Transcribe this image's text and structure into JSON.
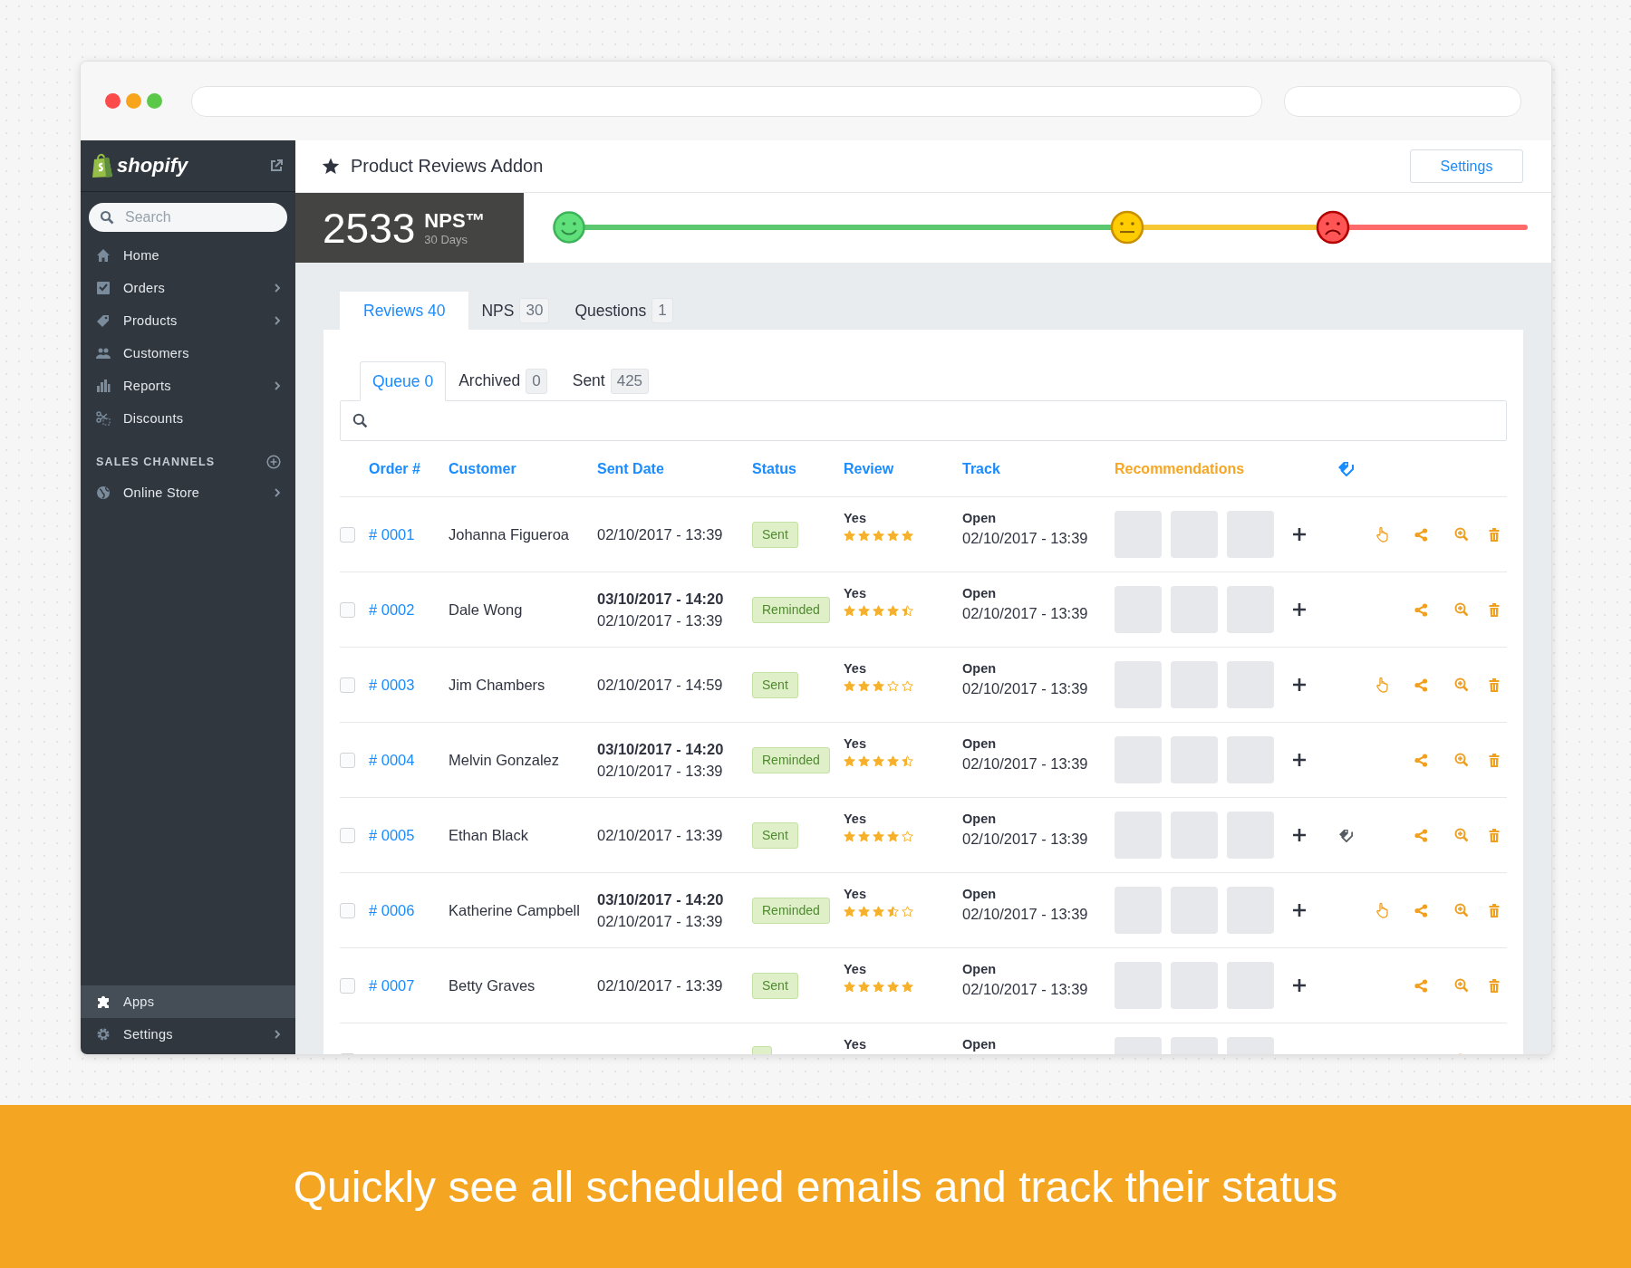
{
  "sidebar": {
    "logo": "shopify",
    "search": {
      "placeholder": "Search"
    },
    "items": [
      {
        "label": "Home",
        "has_children": false,
        "selected": false
      },
      {
        "label": "Orders",
        "has_children": true,
        "selected": false
      },
      {
        "label": "Products",
        "has_children": true,
        "selected": false
      },
      {
        "label": "Customers",
        "has_children": false,
        "selected": false
      },
      {
        "label": "Reports",
        "has_children": true,
        "selected": false
      },
      {
        "label": "Discounts",
        "has_children": false,
        "selected": false
      }
    ],
    "section_title": "SALES CHANNELS",
    "channels": [
      {
        "label": "Online Store",
        "has_children": true,
        "selected": false
      }
    ],
    "bottom_items": [
      {
        "label": "Apps",
        "has_children": false,
        "selected": true
      },
      {
        "label": "Settings",
        "has_children": true,
        "selected": false
      }
    ]
  },
  "header": {
    "title": "Product Reviews Addon",
    "settings_button": "Settings"
  },
  "nps": {
    "score": "2533",
    "label": "NPS™",
    "period": "30 Days"
  },
  "tabs": [
    {
      "label": "Reviews",
      "count": "40",
      "selected": true
    },
    {
      "label": "NPS",
      "count": "30",
      "selected": false
    },
    {
      "label": "Questions",
      "count": "1",
      "selected": false
    }
  ],
  "subtabs": [
    {
      "label": "Queue",
      "count": "0",
      "selected": true
    },
    {
      "label": "Archived",
      "count": "0",
      "selected": false
    },
    {
      "label": "Sent",
      "count": "425",
      "selected": false
    }
  ],
  "table": {
    "columns": [
      "Order #",
      "Customer",
      "Sent Date",
      "Status",
      "Review",
      "Track",
      "Recommendations"
    ],
    "rows": [
      {
        "checked": false,
        "order": "# 0001",
        "customer": "Johanna Figueroa",
        "sent_date": "02/10/2017 - 13:39",
        "status": "Sent",
        "review": "Yes",
        "stars": 5,
        "track": "Open",
        "track_date": "02/10/2017 - 13:39",
        "pointer": true,
        "tagged": false
      },
      {
        "checked": false,
        "order": "# 0002",
        "customer": "Dale Wong",
        "reminded_date": "03/10/2017 - 14:20",
        "sent_date": "02/10/2017 - 13:39",
        "status": "Reminded",
        "review": "Yes",
        "stars": 4.5,
        "track": "Open",
        "track_date": "02/10/2017 - 13:39",
        "pointer": false,
        "tagged": false
      },
      {
        "checked": false,
        "order": "# 0003",
        "customer": "Jim Chambers",
        "sent_date": "02/10/2017 - 14:59",
        "status": "Sent",
        "review": "Yes",
        "stars": 3,
        "track": "Open",
        "track_date": "02/10/2017 - 13:39",
        "pointer": true,
        "tagged": false
      },
      {
        "checked": false,
        "order": "# 0004",
        "customer": "Melvin Gonzalez",
        "reminded_date": "03/10/2017 - 14:20",
        "sent_date": "02/10/2017 - 13:39",
        "status": "Reminded",
        "review": "Yes",
        "stars": 4.5,
        "track": "Open",
        "track_date": "02/10/2017 - 13:39",
        "pointer": false,
        "tagged": false
      },
      {
        "checked": false,
        "order": "# 0005",
        "customer": "Ethan Black",
        "sent_date": "02/10/2017 - 13:39",
        "status": "Sent",
        "review": "Yes",
        "stars": 4,
        "track": "Open",
        "track_date": "02/10/2017 - 13:39",
        "pointer": false,
        "tagged": true
      },
      {
        "checked": false,
        "order": "# 0006",
        "customer": "Katherine Campbell",
        "reminded_date": "03/10/2017 - 14:20",
        "sent_date": "02/10/2017 - 13:39",
        "status": "Reminded",
        "review": "Yes",
        "stars": 3.5,
        "track": "Open",
        "track_date": "02/10/2017 - 13:39",
        "pointer": true,
        "tagged": false
      },
      {
        "checked": false,
        "order": "# 0007",
        "customer": "Betty Graves",
        "sent_date": "02/10/2017 - 13:39",
        "status": "Sent",
        "review": "Yes",
        "stars": 5,
        "track": "Open",
        "track_date": "02/10/2017 - 13:39",
        "pointer": false,
        "tagged": false
      },
      {
        "checked": false,
        "review": "Yes",
        "track": "Open",
        "pointer": false,
        "tagged": false
      }
    ]
  },
  "caption": "Quickly see all scheduled emails and track their status"
}
